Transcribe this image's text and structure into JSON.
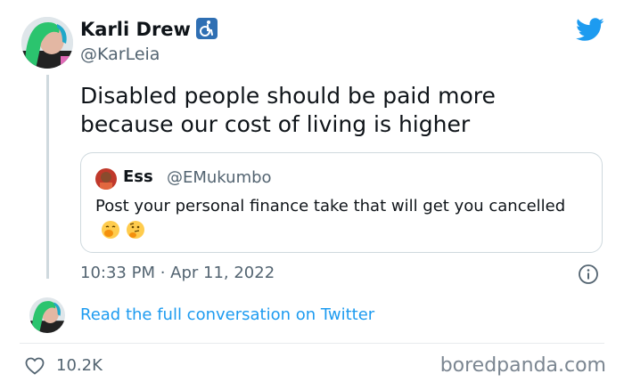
{
  "author": {
    "name": "Karli Drew",
    "handle": "@KarLeia",
    "badge_icon": "wheelchair-icon"
  },
  "tweet": {
    "text": "Disabled people should be paid more because our cost of living is higher",
    "timestamp": "10:33 PM · Apr 11, 2022"
  },
  "quote": {
    "name": "Ess",
    "handle": "@EMukumbo",
    "text": "Post your personal finance take that will get you cancelled",
    "emojis": [
      "face-with-hand-over-mouth-icon",
      "thinking-face-icon"
    ]
  },
  "footer": {
    "read_more": "Read the full conversation on Twitter",
    "likes": "10.2K",
    "watermark": "boredpanda.com"
  },
  "colors": {
    "link": "#1d9bf0",
    "twitter_blue": "#1d9bf0",
    "secondary_text": "#536471",
    "border": "#cfd9de"
  }
}
